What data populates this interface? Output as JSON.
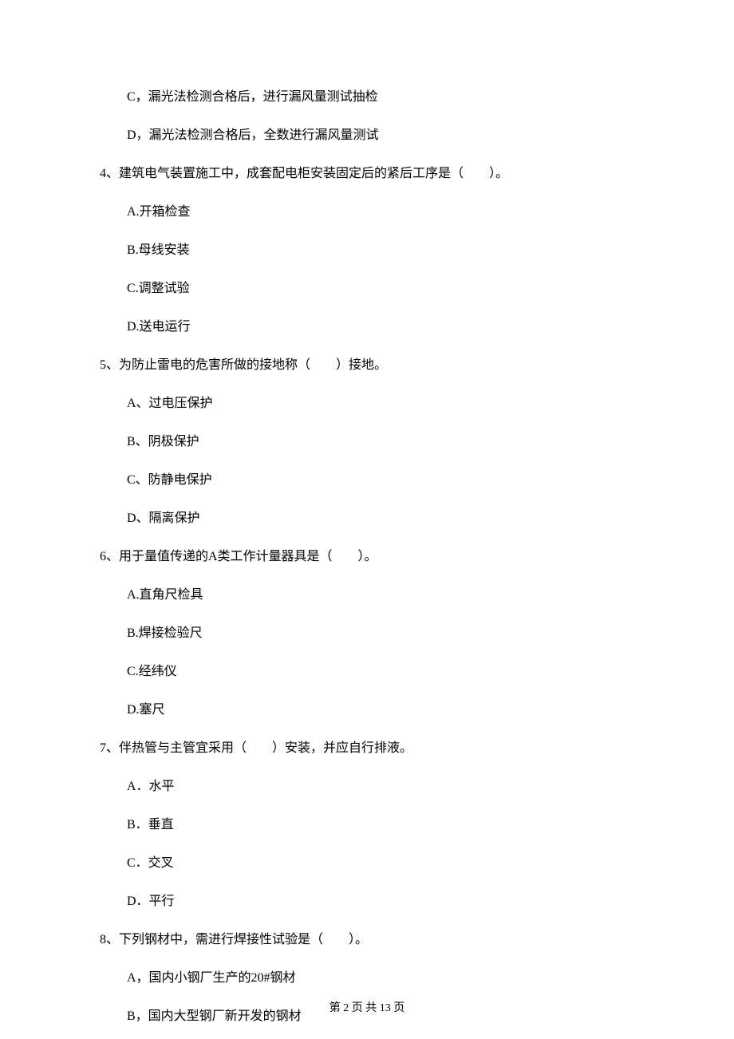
{
  "q3_remaining": {
    "optC": "C，漏光法检测合格后，进行漏风量测试抽检",
    "optD": "D，漏光法检测合格后，全数进行漏风量测试"
  },
  "q4": {
    "stem": "4、建筑电气装置施工中，成套配电柜安装固定后的紧后工序是（　　）。",
    "optA": "A.开箱检查",
    "optB": "B.母线安装",
    "optC": "C.调整试验",
    "optD": "D.送电运行"
  },
  "q5": {
    "stem": "5、为防止雷电的危害所做的接地称（　　）接地。",
    "optA": "A、过电压保护",
    "optB": "B、阴极保护",
    "optC": "C、防静电保护",
    "optD": "D、隔离保护"
  },
  "q6": {
    "stem": "6、用于量值传递的A类工作计量器具是（　　）。",
    "optA": "A.直角尺检具",
    "optB": "B.焊接检验尺",
    "optC": "C.经纬仪",
    "optD": "D.塞尺"
  },
  "q7": {
    "stem": "7、伴热管与主管宜采用（　　）安装，并应自行排液。",
    "optA": "A．水平",
    "optB": "B．垂直",
    "optC": "C．交叉",
    "optD": "D．平行"
  },
  "q8": {
    "stem": "8、下列钢材中，需进行焊接性试验是（　　）。",
    "optA": "A，国内小钢厂生产的20#钢材",
    "optB": "B，国内大型钢厂新开发的钢材"
  },
  "footer": "第 2 页 共 13 页"
}
